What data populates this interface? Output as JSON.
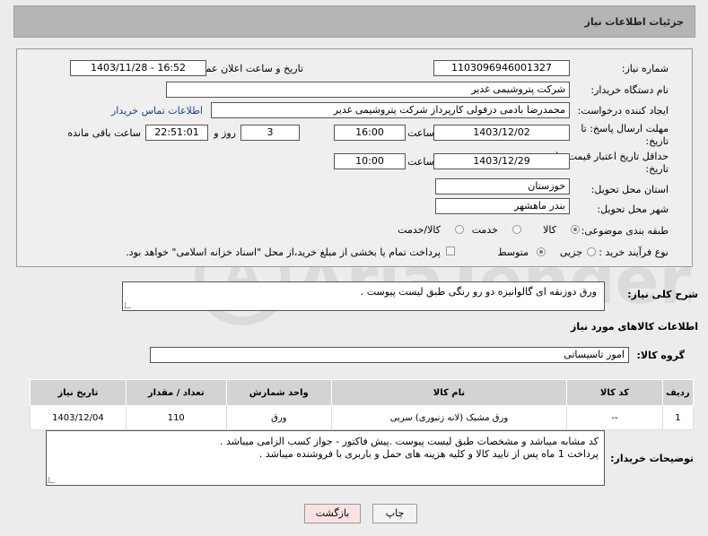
{
  "header": {
    "title": "جزئیات اطلاعات نیاز"
  },
  "form": {
    "need_number_label": "شماره نیاز:",
    "need_number": "1103096946001327",
    "announce_label": "تاریخ و ساعت اعلان عمومی:",
    "announce_value": "1403/11/28 - 16:52",
    "buyer_label": "نام دستگاه خریدار:",
    "buyer_value": "شرکت پتروشیمی غدیر",
    "creator_label": "ایجاد کننده درخواست:",
    "creator_value": "محمدرضا بادمی دزفولی کارپرداز شرکت پتروشیمی غدیر",
    "contact_link": "اطلاعات تماس خریدار",
    "deadline_label_1": "مهلت ارسال پاسخ: تا",
    "deadline_label_2": "تاریخ:",
    "deadline_date": "1403/12/02",
    "time_label": "ساعت",
    "deadline_time": "16:00",
    "days_value": "3",
    "days_label": "روز و",
    "remaining_time": "22:51:01",
    "remaining_label": "ساعت باقی مانده",
    "validity_label_1": "حداقل تاریخ اعتبار قیمت: تا",
    "validity_label_2": "تاریخ:",
    "validity_date": "1403/12/29",
    "validity_time_label": "ساعت",
    "validity_time": "10:00",
    "province_label": "استان محل تحویل:",
    "province_value": "خوزستان",
    "city_label": "شهر محل تحویل:",
    "city_value": "بندر ماهشهر",
    "category_label": "طبقه بندی موضوعی:",
    "category_options": [
      "کالا",
      "خدمت",
      "کالا/خدمت"
    ],
    "purchase_label": "نوع فرآیند خرید :",
    "purchase_options": [
      "جزیی",
      "متوسط"
    ],
    "payment_text": "پرداخت تمام یا بخشی از مبلغ خرید،از محل \"اسناد خزانه اسلامی\" خواهد بود."
  },
  "description": {
    "label": "شرح کلی نیاز:",
    "value": "ورق دوزنقه ای گالوانیزه دو رو رنگی طبق لیست پیوست ."
  },
  "goods_section": {
    "title": "اطلاعات کالاهای مورد نیاز"
  },
  "goods_group": {
    "label": "گروه کالا:",
    "value": "امور تاسیساتی"
  },
  "table": {
    "headers": [
      "ردیف",
      "کد کالا",
      "نام کالا",
      "واحد شمارش",
      "تعداد / مقدار",
      "تاریخ نیاز"
    ],
    "rows": [
      [
        "1",
        "--",
        "ورق مشبک (لانه زنبوری) سربی",
        "ورق",
        "110",
        "1403/12/04"
      ]
    ]
  },
  "buyer_notes": {
    "label": "توضیحات خریدار:",
    "line1": "کد مشابه میباشد و مشخصات طبق لیست پیوست .پیش فاکتور - جواز کسب الزامی میباشد .",
    "line2": "پرداخت 1 ماه پس از تایید کالا و کلیه هزینه های حمل و باربری با فروشنده میباشد ."
  },
  "buttons": {
    "print": "چاپ",
    "back": "بازگشت"
  },
  "watermark": "AriaTender.net"
}
